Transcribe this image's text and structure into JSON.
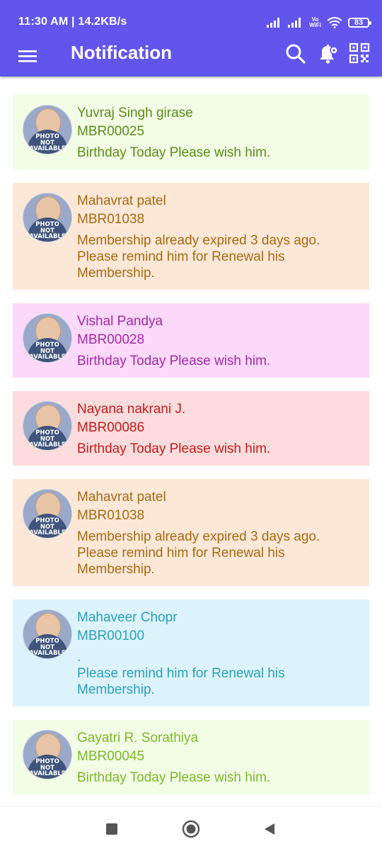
{
  "status_bar": {
    "time": "11:30 AM | 14.2KB/s",
    "volte_top": "Vo",
    "volte_bottom": "WiFi",
    "battery": "83"
  },
  "app_bar": {
    "title": "Notification"
  },
  "avatar_placeholder": {
    "line1": "PHOTO",
    "line2": "NOT",
    "line3": "AVAILABLE"
  },
  "notifications": [
    {
      "name": "Yuvraj Singh girase",
      "member_id": "MBR00025",
      "message": "Birthday Today Please wish him.",
      "bg": "#f2fde5",
      "color": "#5c8c1a"
    },
    {
      "name": "Mahavrat patel",
      "member_id": "MBR01038",
      "message": "Membership already expired 3 days ago.\nPlease remind him for Renewal his\nMembership.",
      "bg": "#fde8d8",
      "color": "#a86a10"
    },
    {
      "name": "Vishal Pandya",
      "member_id": "MBR00028",
      "message": "Birthday Today Please wish him.",
      "bg": "#fcd9fa",
      "color": "#a32aa8"
    },
    {
      "name": "Nayana nakrani J.",
      "member_id": "MBR00086",
      "message": "Birthday Today Please wish him.",
      "bg": "#fcdcdc",
      "color": "#c31d1d"
    },
    {
      "name": "Mahavrat patel",
      "member_id": "MBR01038",
      "message": "Membership already expired 3 days ago.\nPlease remind him for Renewal his\nMembership.",
      "bg": "#fde8d8",
      "color": "#a86a10"
    },
    {
      "name": "Mahaveer Chopr",
      "member_id": "MBR00100",
      "message": ".\nPlease remind him for Renewal his\nMembership.",
      "bg": "#dcf3fb",
      "color": "#2aa1bd"
    },
    {
      "name": "Gayatri R. Sorathiya",
      "member_id": "MBR00045",
      "message": "Birthday Today Please wish him.",
      "bg": "#f2fde5",
      "color": "#7cb82a"
    }
  ]
}
